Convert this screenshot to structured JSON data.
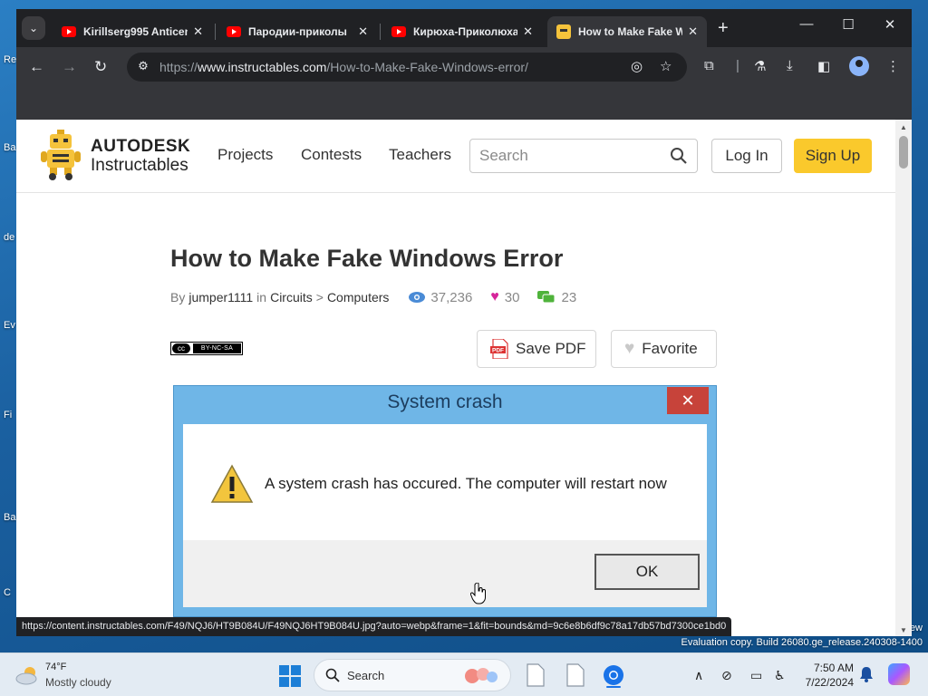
{
  "desktop": {
    "icon_labels": [
      "Re",
      "Ba",
      "de",
      "Ev",
      "Fi",
      "Ba",
      "C"
    ],
    "watermark_line1": "ew",
    "watermark_line2": "Evaluation copy. Build 26080.ge_release.240308-1400"
  },
  "browser": {
    "tabs": [
      {
        "title": "Kirillserg995 Anticen",
        "icon": "youtube-icon"
      },
      {
        "title": "Пародии-приколы",
        "icon": "youtube-icon"
      },
      {
        "title": "Кирюха-Приколюха",
        "icon": "youtube-icon"
      },
      {
        "title": "How to Make Fake W",
        "icon": "instructables-robot-icon",
        "active": true
      }
    ],
    "url_scheme": "https://",
    "url_host": "www.instructables.com",
    "url_path": "/How-to-Make-Fake-Windows-error/",
    "status_url": "https://content.instructables.com/F49/NQJ6/HT9B084U/F49NQJ6HT9B084U.jpg?auto=webp&frame=1&fit=bounds&md=9c6e8b6df9c78a17db57bd7300ce1bd0"
  },
  "site": {
    "logo_line1": "AUTODESK",
    "logo_line2": "Instructables",
    "nav": [
      "Projects",
      "Contests",
      "Teachers"
    ],
    "search_placeholder": "Search",
    "login": "Log In",
    "signup": "Sign Up"
  },
  "article": {
    "title": "How to Make Fake Windows Error",
    "by": "By",
    "author": "jumper1111",
    "in": "in",
    "category": "Circuits",
    "sep": ">",
    "subcategory": "Computers",
    "views": "37,236",
    "favorites": "30",
    "comments": "23",
    "license_cc": "cc",
    "license": "BY-NC-SA",
    "save_pdf": "Save PDF",
    "favorite": "Favorite",
    "pdf_icon_text": "PDF"
  },
  "dialog": {
    "title": "System crash",
    "close": "✕",
    "message": "A system crash has occured. The computer will restart now",
    "ok": "OK"
  },
  "taskbar": {
    "temp": "74°F",
    "weather": "Mostly cloudy",
    "search_label": "Search",
    "time": "7:50 AM",
    "date": "7/22/2024"
  },
  "colors": {
    "signup_bg": "#fac92c",
    "dialog_frame": "#6fb6e7",
    "dialog_close": "#c7433a",
    "views_icon": "#4a8bd6",
    "heart": "#d6259a",
    "comments_icon": "#4fb33b"
  }
}
